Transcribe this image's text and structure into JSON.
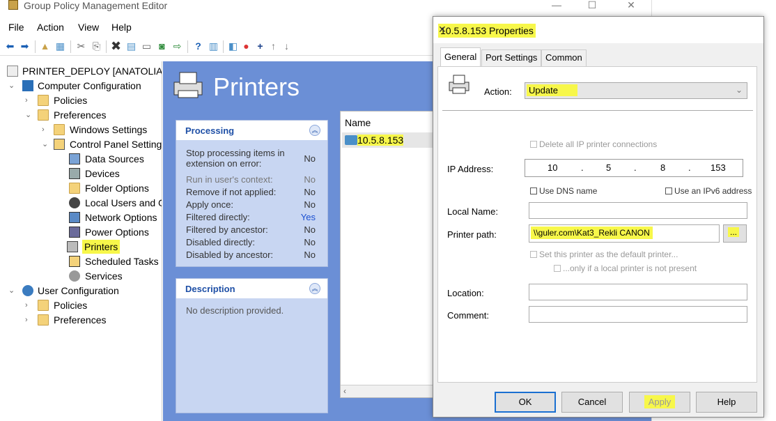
{
  "window": {
    "title": "Group Policy Management Editor",
    "min": "—",
    "max": "☐",
    "close": "✕"
  },
  "menu": [
    "File",
    "Action",
    "View",
    "Help"
  ],
  "tree": {
    "root": "PRINTER_DEPLOY [ANATOLIA.GUI",
    "computer_configuration": "Computer Configuration",
    "policies": "Policies",
    "preferences": "Preferences",
    "windows_settings": "Windows Settings",
    "control_panel_settings": "Control Panel Setting",
    "data_sources": "Data Sources",
    "devices": "Devices",
    "folder_options": "Folder Options",
    "local_users": "Local Users and G",
    "network_options": "Network Options",
    "power_options": "Power Options",
    "printers": "Printers",
    "scheduled_tasks": "Scheduled Tasks",
    "services": "Services",
    "user_configuration": "User Configuration",
    "user_policies": "Policies",
    "user_preferences": "Preferences"
  },
  "content": {
    "title": "Printers",
    "processing": {
      "heading": "Processing",
      "rows": [
        {
          "label": "Stop processing items in extension on error:",
          "value": "No"
        },
        {
          "label": "Run in user's context:",
          "value": "No"
        },
        {
          "label": "Remove if not applied:",
          "value": "No"
        },
        {
          "label": "Apply once:",
          "value": "No"
        },
        {
          "label": "Filtered directly:",
          "value": "Yes"
        },
        {
          "label": "Filtered by ancestor:",
          "value": "No"
        },
        {
          "label": "Disabled directly:",
          "value": "No"
        },
        {
          "label": "Disabled by ancestor:",
          "value": "No"
        }
      ]
    },
    "description": {
      "heading": "Description",
      "text": "No description provided."
    },
    "list": {
      "header": "Name",
      "item": "10.5.8.153"
    }
  },
  "dialog": {
    "title": "10.5.8.153 Properties",
    "tabs": [
      "General",
      "Port Settings",
      "Common"
    ],
    "action_label": "Action:",
    "action_value": "Update",
    "delete_all": "Delete all IP printer connections",
    "ip_label": "IP Address:",
    "ip": [
      "10",
      "5",
      "8",
      "153"
    ],
    "ip_dot": ".",
    "use_dns": "Use DNS name",
    "use_ipv6": "Use an IPv6 address",
    "local_name_label": "Local Name:",
    "local_name": "",
    "printer_path_label": "Printer path:",
    "printer_path": "\\\\guler.com\\Kat3_Rekli CANON",
    "browse": "...",
    "set_default": "Set this printer as the default printer...",
    "only_if": "...only if a local printer is not present",
    "location_label": "Location:",
    "location": "",
    "comment_label": "Comment:",
    "comment": "",
    "buttons": {
      "ok": "OK",
      "cancel": "Cancel",
      "apply": "Apply",
      "help": "Help"
    }
  }
}
